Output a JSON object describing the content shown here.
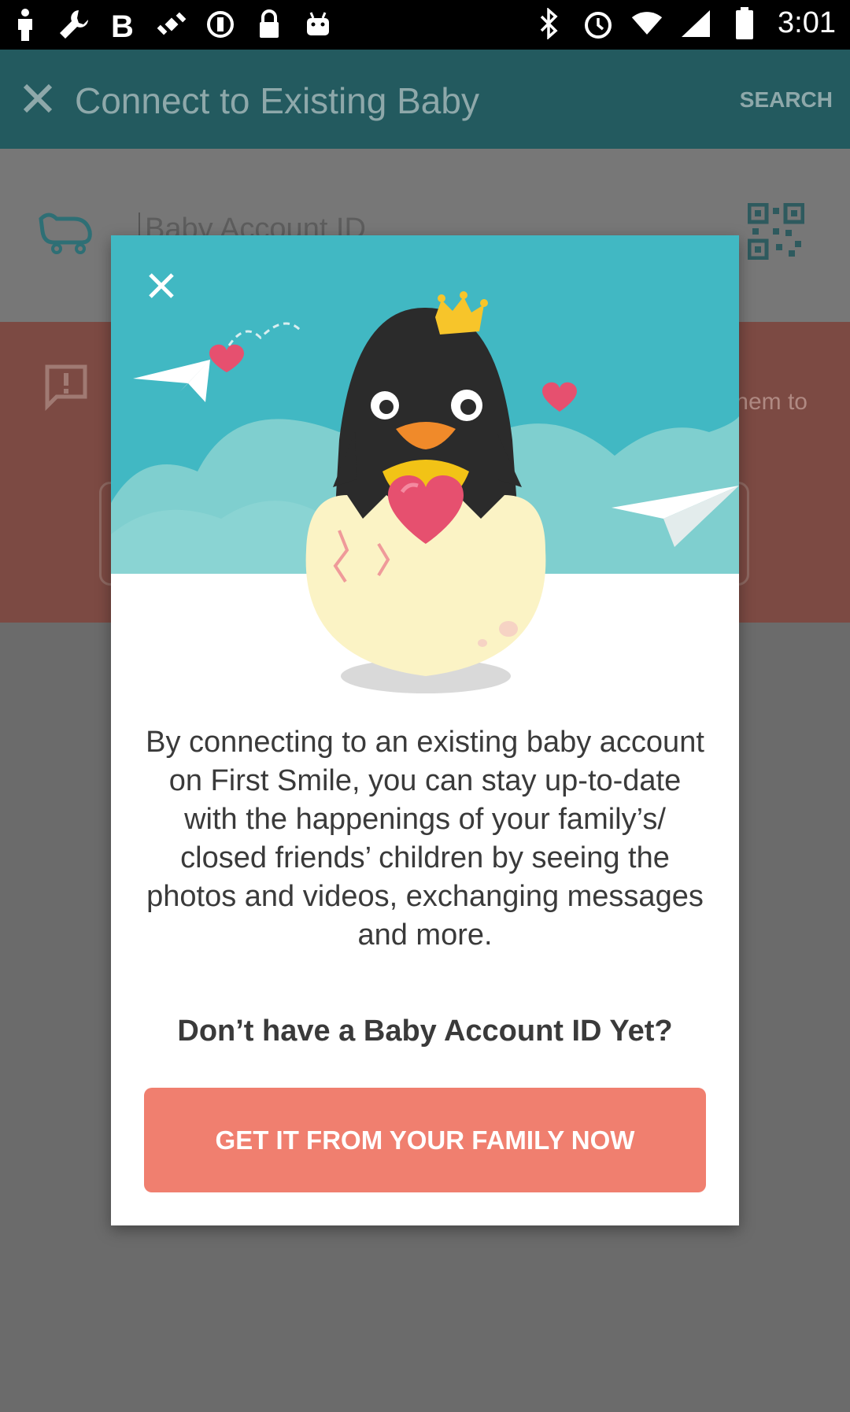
{
  "status_bar": {
    "time": "3:01",
    "left_icons": [
      "person-icon",
      "wrench-icon",
      "b-icon",
      "satellite-icon",
      "dnd-icon",
      "lock-icon",
      "android-icon"
    ],
    "right_icons": [
      "bluetooth-icon",
      "alarm-icon",
      "wifi-icon",
      "signal-icon",
      "battery-icon"
    ]
  },
  "app_bar": {
    "title": "Connect to Existing Baby",
    "search_label": "SEARCH"
  },
  "baby_id": {
    "placeholder": "Baby Account ID"
  },
  "alert": {
    "text_fragment": "hem to"
  },
  "dialog": {
    "body": "By connecting to an existing baby account on First Smile, you can stay up-to-date with the happenings of your family’s/ closed friends’ children by seeing the photos and videos, exchanging messages and more.",
    "question": "Don’t have a Baby Account ID Yet?",
    "cta_label": "GET IT FROM YOUR FAMILY NOW"
  },
  "colors": {
    "app_bar": "#235a5f",
    "hero_sky": "#41b8c3",
    "cta": "#f07f6f",
    "overlay": "#6b6b6b"
  }
}
